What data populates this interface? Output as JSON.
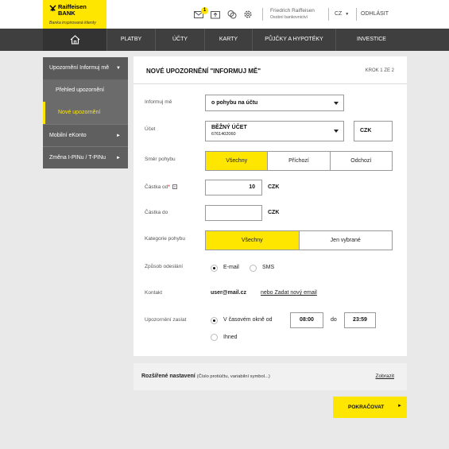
{
  "header": {
    "brand_name_line1": "Raiffeisen",
    "brand_name_line2": "BANK",
    "brand_tagline": "Banka inspirovaná klienty",
    "notification_count": "1",
    "user_name": "Friedrich Raiffeisen",
    "user_role": "Osobní bankovnictví",
    "language": "CZ",
    "logout": "ODHLÁSIT",
    "icons": [
      "envelope-icon",
      "inbox-upload-icon",
      "exchange-icon",
      "gear-icon"
    ]
  },
  "nav": {
    "home_icon": "home-icon",
    "items": [
      "PLATBY",
      "ÚČTY",
      "KARTY",
      "PŮJČKY A HYPOTÉKY",
      "INVESTICE"
    ]
  },
  "sidebar": {
    "items": [
      {
        "label": "Upozornění Informuj mě",
        "state": "expanded"
      },
      {
        "label": "Přehled upozornění",
        "state": "sub"
      },
      {
        "label": "Nové upozornění",
        "state": "sub-active"
      },
      {
        "label": "Mobilní eKonto",
        "state": "collapsed"
      },
      {
        "label": "Změna I-PINu / T-PINu",
        "state": "collapsed"
      }
    ]
  },
  "form": {
    "title": "NOVÉ UPOZORNĚNÍ \"INFORMUJ MĚ\"",
    "step": "KROK 1 ZE 2",
    "informuj_label": "Informuj mě",
    "informuj_value": "o pohybu na účtu",
    "ucet_label": "Účet",
    "ucet_name": "BĚŽNÝ ÚČET",
    "ucet_number": "6761402060",
    "ucet_currency": "CZK",
    "smer_label": "Směr pohybu",
    "smer_options": [
      "Všechny",
      "Příchozí",
      "Odchozí"
    ],
    "smer_selected": 0,
    "castka_od_label": "Částka od",
    "castka_od_required": "*",
    "castka_od_help": "?",
    "castka_od_value": "10",
    "castka_do_label": "Částka do",
    "castka_do_value": "",
    "currency": "CZK",
    "kategorie_label": "Kategorie pohybu",
    "kategorie_options": [
      "Všechny",
      "Jen vybrané"
    ],
    "kategorie_selected": 0,
    "zpusob_label": "Způsob odeslání",
    "zpusob_options": [
      "E-mail",
      "SMS"
    ],
    "zpusob_selected": 0,
    "kontakt_label": "Kontakt",
    "kontakt_value": "user@mail.cz",
    "kontakt_link": "nebo Zadat nový email",
    "zaslat_label": "Upozornění zaslat",
    "zaslat_window": "V časovém okně od",
    "zaslat_from": "08:00",
    "zaslat_to_label": "do",
    "zaslat_to": "23:59",
    "zaslat_now": "Ihned",
    "zaslat_selected": 0
  },
  "advanced": {
    "title": "Rozšířené nastavení",
    "hint": "(Číslo protiúčtu, variabilní symbol...)",
    "link": "Zobrazit"
  },
  "continue_button": "POKRAČOVAT",
  "colors": {
    "accent": "#fee600",
    "nav": "#3f3f3f",
    "sidebar": "#6b6b6b"
  }
}
